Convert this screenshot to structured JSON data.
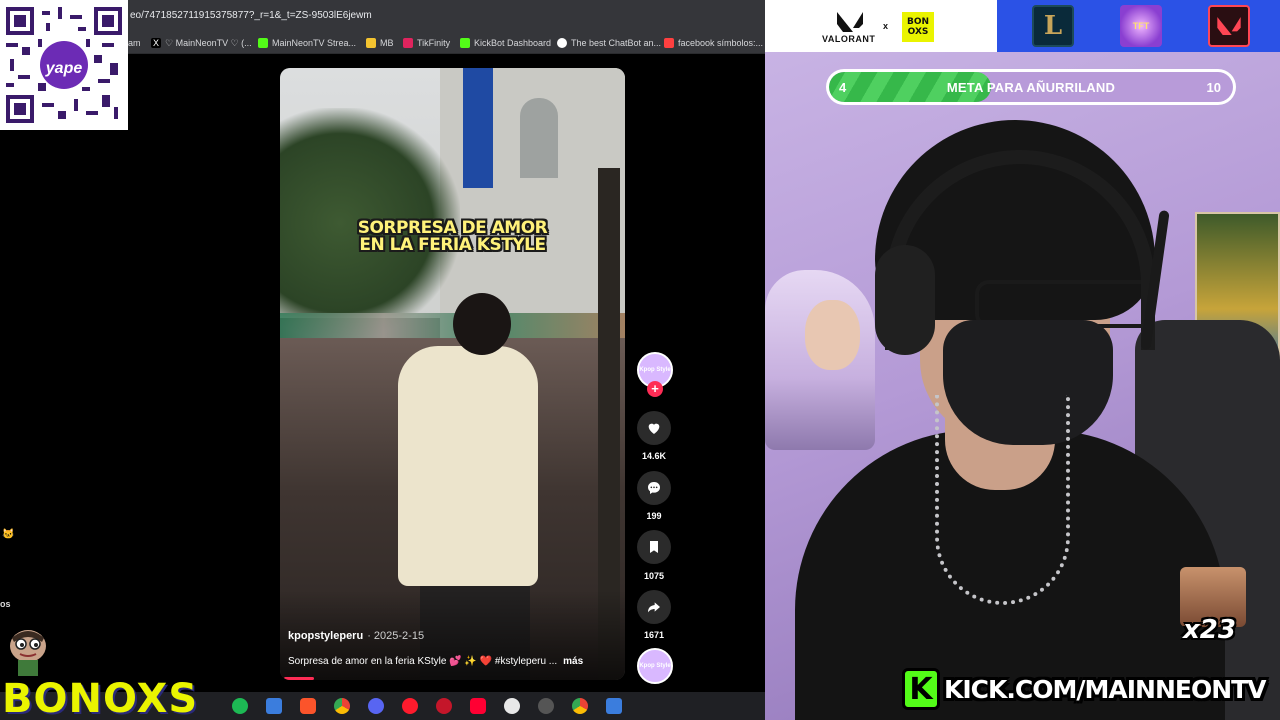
{
  "browser": {
    "url": "eo/7471852711915375877?_r=1&_t=ZS-9503lE6jewm",
    "bookmarks": [
      {
        "label": "am",
        "icon": "generic-favicon",
        "color": "#8a8a8a"
      },
      {
        "label": "♡ MainNeonTV ♡ (...",
        "icon": "x-icon",
        "color": "#ffffff"
      },
      {
        "label": "MainNeonTV Strea...",
        "icon": "kick-icon",
        "color": "#53fc18"
      },
      {
        "label": "MB",
        "icon": "mb-icon",
        "color": "#f4c430"
      },
      {
        "label": "TikFinity",
        "icon": "tikfinity-icon",
        "color": "#e0245e"
      },
      {
        "label": "KickBot Dashboard",
        "icon": "kickbot-icon",
        "color": "#53fc18"
      },
      {
        "label": "The best ChatBot an...",
        "icon": "chatbot-icon",
        "color": "#ffffff"
      },
      {
        "label": "facebook símbolos:...",
        "icon": "lightning-icon",
        "color": "#ff4040"
      }
    ]
  },
  "qr": {
    "brand": "yape"
  },
  "video": {
    "caption_line1": "SORPRESA DE AMOR",
    "caption_line2": "EN LA FERIA KSTYLE",
    "author": "kpopstyleperu",
    "date": "· 2025-2-15",
    "description": "Sorpresa de amor en la feria KStyle 💕 ✨ ❤️ #kstyleperu ...",
    "more": "más",
    "avatar_text": "Kpop Style",
    "actions": {
      "likes": "14.6K",
      "comments": "199",
      "saves": "1075",
      "shares": "1671"
    }
  },
  "chat": {
    "emoji": "🐱",
    "fragment": "os"
  },
  "overlay": {
    "bonoxs_logo": "BONOXS",
    "valorant_text": "VALORANT",
    "separator": "x",
    "bonoxs_badge_line1": "BON",
    "bonoxs_badge_line2": "OXS",
    "lol_logo": "L",
    "tft_logo": "TFT",
    "goal": {
      "start": "4",
      "label": "META PARA AÑURRILAND",
      "end": "10",
      "progress": 0.4
    },
    "emote_count": "x23",
    "kick_url": "KICK.COM/MAINNEONTV",
    "kick_letter": "K"
  },
  "colors": {
    "accent_green": "#53fc18",
    "bonoxs_yellow": "#eaf400",
    "tiktok_red": "#fe2c55",
    "logo_blue": "#2b52e6"
  }
}
